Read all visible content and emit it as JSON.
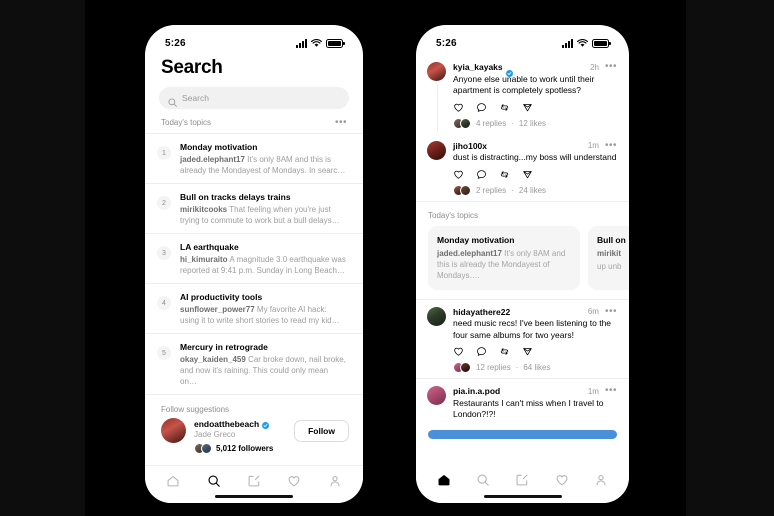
{
  "statusbar": {
    "time": "5:26"
  },
  "left_phone": {
    "title": "Search",
    "search": {
      "placeholder": "Search",
      "icon": "search-icon"
    },
    "topics_header": {
      "label": "Today's topics",
      "more_icon": "ellipsis-icon"
    },
    "topics": [
      {
        "rank": "1",
        "title": "Monday motivation",
        "user": "jaded.elephant17",
        "snippet": "It's only 8AM and this is already the Mondayest of Mondays. In searc…"
      },
      {
        "rank": "2",
        "title": "Bull on tracks delays trains",
        "user": "mirikitcooks",
        "snippet": "That feeling when you're just trying to commute to work but a bull delays…"
      },
      {
        "rank": "3",
        "title": "LA earthquake",
        "user": "hi_kimuraito",
        "snippet": "A magnitude 3.0 earthquake was reported at 9:41 p.m. Sunday in Long Beach…"
      },
      {
        "rank": "4",
        "title": "AI productivity tools",
        "user": "sunflower_power77",
        "snippet": "My favorite AI hack: using it to write short stories to read my kid…"
      },
      {
        "rank": "5",
        "title": "Mercury in retrograde",
        "user": "okay_kaiden_459",
        "snippet": "Car broke down, nail broke, and now it's raining. This could only mean on…"
      }
    ],
    "follow_suggestions": {
      "label": "Follow suggestions",
      "user": {
        "handle": "endoatthebeach",
        "name": "Jade Greco",
        "followers": "5,012 followers",
        "verified": true
      },
      "button": "Follow"
    },
    "tabbar": {
      "items": [
        "home-icon",
        "search-icon",
        "compose-icon",
        "activity-icon",
        "profile-icon"
      ],
      "active": "search-icon"
    }
  },
  "right_phone": {
    "posts": [
      {
        "user": "kyia_kayaks",
        "verified": true,
        "time": "2h",
        "text": "Anyone else unable to work until their apartment is completely spotless?",
        "replies": "4 replies",
        "likes": "12 likes",
        "sep": false
      },
      {
        "user": "jiho100x",
        "verified": false,
        "time": "1m",
        "text": "dust is distracting...my boss will understand",
        "replies": "2 replies",
        "likes": "24 likes",
        "sep": false
      },
      {
        "user": "hidayathere22",
        "verified": false,
        "time": "6m",
        "text": "need music recs! I've been listening to the four same albums for two years!",
        "replies": "12 replies",
        "likes": "64 likes",
        "sep": true
      },
      {
        "user": "pia.in.a.pod",
        "verified": false,
        "time": "1m",
        "text": "Restaurants I can't miss when I travel to London?!?!",
        "replies": "",
        "likes": "",
        "sep": true
      }
    ],
    "topics_strip": {
      "label": "Today's topics",
      "cards": [
        {
          "title": "Monday motivation",
          "user": "jaded.elephant17",
          "snippet": "It's only 8AM and this is already the Mondayest of Mondays…."
        },
        {
          "title": "Bull on",
          "user": "mirikit",
          "snippet": "up unb"
        }
      ]
    },
    "highlight_bar_color": "#4a90d9",
    "tabbar": {
      "items": [
        "home-icon",
        "search-icon",
        "compose-icon",
        "activity-icon",
        "profile-icon"
      ],
      "active": "home-icon"
    },
    "post_more_icon": "ellipsis-icon",
    "action_icons": [
      "like-icon",
      "reply-icon",
      "repost-icon",
      "share-icon"
    ]
  },
  "colors": {
    "verified_blue": "#1d9bf0",
    "page_bg": "#0d0d0d",
    "band_bg": "#000000"
  }
}
